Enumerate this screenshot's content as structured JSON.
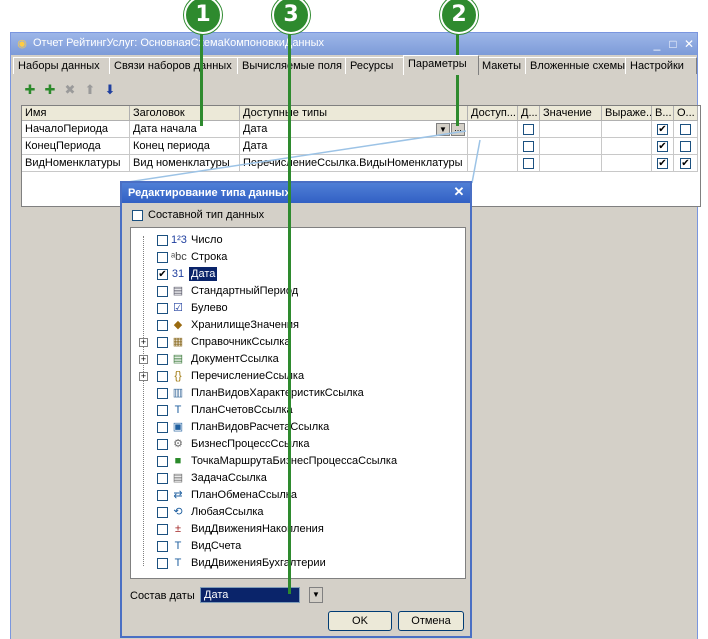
{
  "callouts": [
    "1",
    "3",
    "2"
  ],
  "window": {
    "title": "Отчет РейтингУслуг: ОсновнаяСхемаКомпоновкиДанных",
    "min_glyph": "_",
    "max_glyph": "□",
    "close_glyph": "✕"
  },
  "tabs": [
    "Наборы данных",
    "Связи наборов данных",
    "Вычисляемые поля",
    "Ресурсы",
    "Параметры",
    "Макеты",
    "Вложенные схемы",
    "Настройки"
  ],
  "active_tab": "Параметры",
  "toolbar_icons": [
    "add-icon",
    "add-child-icon",
    "delete-icon",
    "move-up-icon",
    "move-down-icon"
  ],
  "grid": {
    "headers": [
      "Имя",
      "Заголовок",
      "Доступные типы",
      "Доступ...",
      "Д...",
      "Значение",
      "Выраже...",
      "В...",
      "О..."
    ],
    "rows": [
      {
        "name": "НачалоПериода",
        "title": "Дата начала",
        "types": "Дата",
        "chk1": false,
        "chk2": true,
        "chk3": false
      },
      {
        "name": "КонецПериода",
        "title": "Конец периода",
        "types": "Дата",
        "chk1": false,
        "chk2": true,
        "chk3": false
      },
      {
        "name": "ВидНоменклатуры",
        "title": "Вид номенклатуры",
        "types": "ПеречислениеСсылка.ВидыНоменклатуры",
        "chk1": false,
        "chk2": true,
        "chk3": true
      }
    ],
    "ellipsis": "...",
    "dropdown_glyph": "▼"
  },
  "dialog": {
    "title": "Редактирование типа данных",
    "composite_label": "Составной тип данных",
    "close_glyph": "✕",
    "items": [
      {
        "label": "Число",
        "checked": false,
        "expandable": false,
        "icon": "number-icon",
        "glyph": "1²3"
      },
      {
        "label": "Строка",
        "checked": false,
        "expandable": false,
        "icon": "string-icon",
        "glyph": "ᵃbc"
      },
      {
        "label": "Дата",
        "checked": true,
        "expandable": false,
        "icon": "date-icon",
        "glyph": "31"
      },
      {
        "label": "СтандартныйПериод",
        "checked": false,
        "expandable": false,
        "icon": "period-icon",
        "glyph": "▤"
      },
      {
        "label": "Булево",
        "checked": false,
        "expandable": false,
        "icon": "boolean-icon",
        "glyph": "☑"
      },
      {
        "label": "ХранилищеЗначения",
        "checked": false,
        "expandable": false,
        "icon": "storage-icon",
        "glyph": "◆"
      },
      {
        "label": "СправочникСсылка",
        "checked": false,
        "expandable": true,
        "icon": "catalog-icon",
        "glyph": "▦"
      },
      {
        "label": "ДокументСсылка",
        "checked": false,
        "expandable": true,
        "icon": "document-icon",
        "glyph": "▤"
      },
      {
        "label": "ПеречислениеСсылка",
        "checked": false,
        "expandable": true,
        "icon": "enum-icon",
        "glyph": "{}"
      },
      {
        "label": "ПланВидовХарактеристикСсылка",
        "checked": false,
        "expandable": false,
        "icon": "chart-of-characteristics-icon",
        "glyph": "▥"
      },
      {
        "label": "ПланСчетовСсылка",
        "checked": false,
        "expandable": false,
        "icon": "chart-of-accounts-icon",
        "glyph": "T"
      },
      {
        "label": "ПланВидовРасчетаСсылка",
        "checked": false,
        "expandable": false,
        "icon": "calculation-types-icon",
        "glyph": "▣"
      },
      {
        "label": "БизнесПроцессСсылка",
        "checked": false,
        "expandable": false,
        "icon": "business-process-icon",
        "glyph": "⚙"
      },
      {
        "label": "ТочкаМаршрутаБизнесПроцессаСсылка",
        "checked": false,
        "expandable": false,
        "icon": "route-point-icon",
        "glyph": "■"
      },
      {
        "label": "ЗадачаСсылка",
        "checked": false,
        "expandable": false,
        "icon": "task-icon",
        "glyph": "▤"
      },
      {
        "label": "ПланОбменаСсылка",
        "checked": false,
        "expandable": false,
        "icon": "exchange-plan-icon",
        "glyph": "⇄"
      },
      {
        "label": "ЛюбаяСсылка",
        "checked": false,
        "expandable": false,
        "icon": "any-ref-icon",
        "glyph": "⟲"
      },
      {
        "label": "ВидДвиженияНакопления",
        "checked": false,
        "expandable": false,
        "icon": "accumulation-movement-icon",
        "glyph": "±"
      },
      {
        "label": "ВидСчета",
        "checked": false,
        "expandable": false,
        "icon": "account-type-icon",
        "glyph": "T"
      },
      {
        "label": "ВидДвиженияБухгалтерии",
        "checked": false,
        "expandable": false,
        "icon": "accounting-movement-icon",
        "glyph": "T"
      }
    ],
    "date_composition_label": "Состав даты",
    "date_composition_value": "Дата",
    "ok_label": "OK",
    "cancel_label": "Отмена"
  },
  "colors": {
    "callout": "#2e8a2e",
    "selection": "#0a246a",
    "dialog_title": "#3260c4"
  }
}
